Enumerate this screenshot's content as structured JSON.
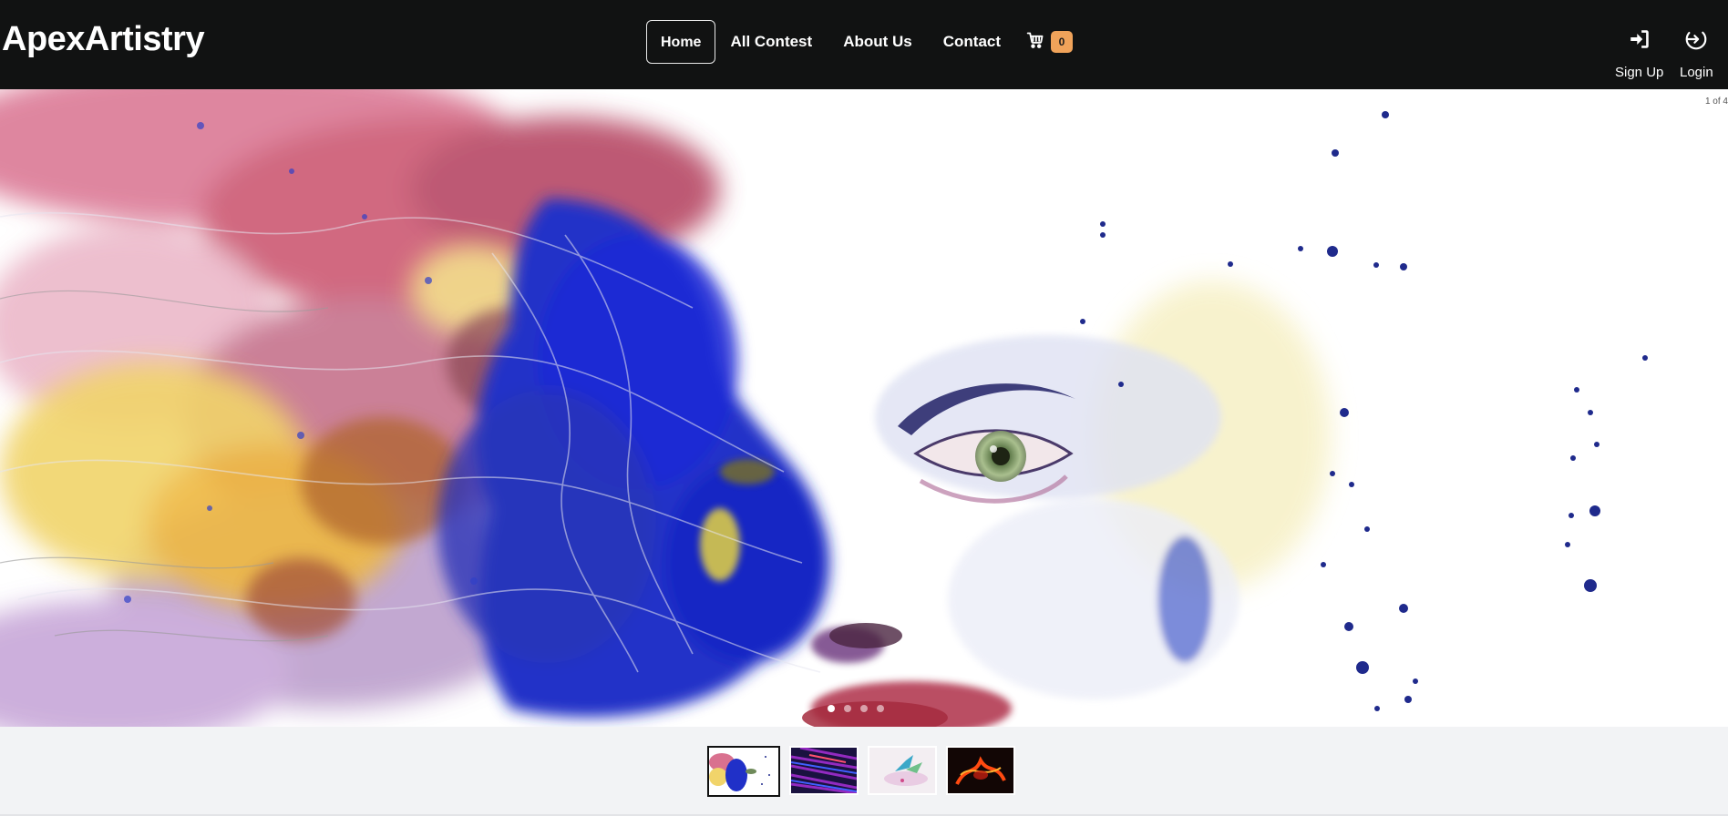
{
  "brand": {
    "name": "ApexArtistry"
  },
  "nav": {
    "links": [
      {
        "label": "Home",
        "active": true
      },
      {
        "label": "All Contest",
        "active": false
      },
      {
        "label": "About Us",
        "active": false
      },
      {
        "label": "Contact",
        "active": false
      }
    ],
    "cart": {
      "icon": "cart-icon",
      "count": "0",
      "badge_color": "#f0a35a"
    }
  },
  "auth": {
    "signup": {
      "label": "Sign Up",
      "icon": "sign-in-icon"
    },
    "login": {
      "label": "Login",
      "icon": "login-icon"
    }
  },
  "carousel": {
    "counter": "1 of 4",
    "total": 4,
    "current": 1,
    "slides": [
      {
        "name": "watercolor-face"
      },
      {
        "name": "abstract-purple-streaks"
      },
      {
        "name": "watercolor-bird"
      },
      {
        "name": "abstract-fire"
      }
    ]
  },
  "colors": {
    "navbar": "#111212",
    "thumb_strip": "#f2f3f5",
    "accent": "#f0a35a"
  }
}
